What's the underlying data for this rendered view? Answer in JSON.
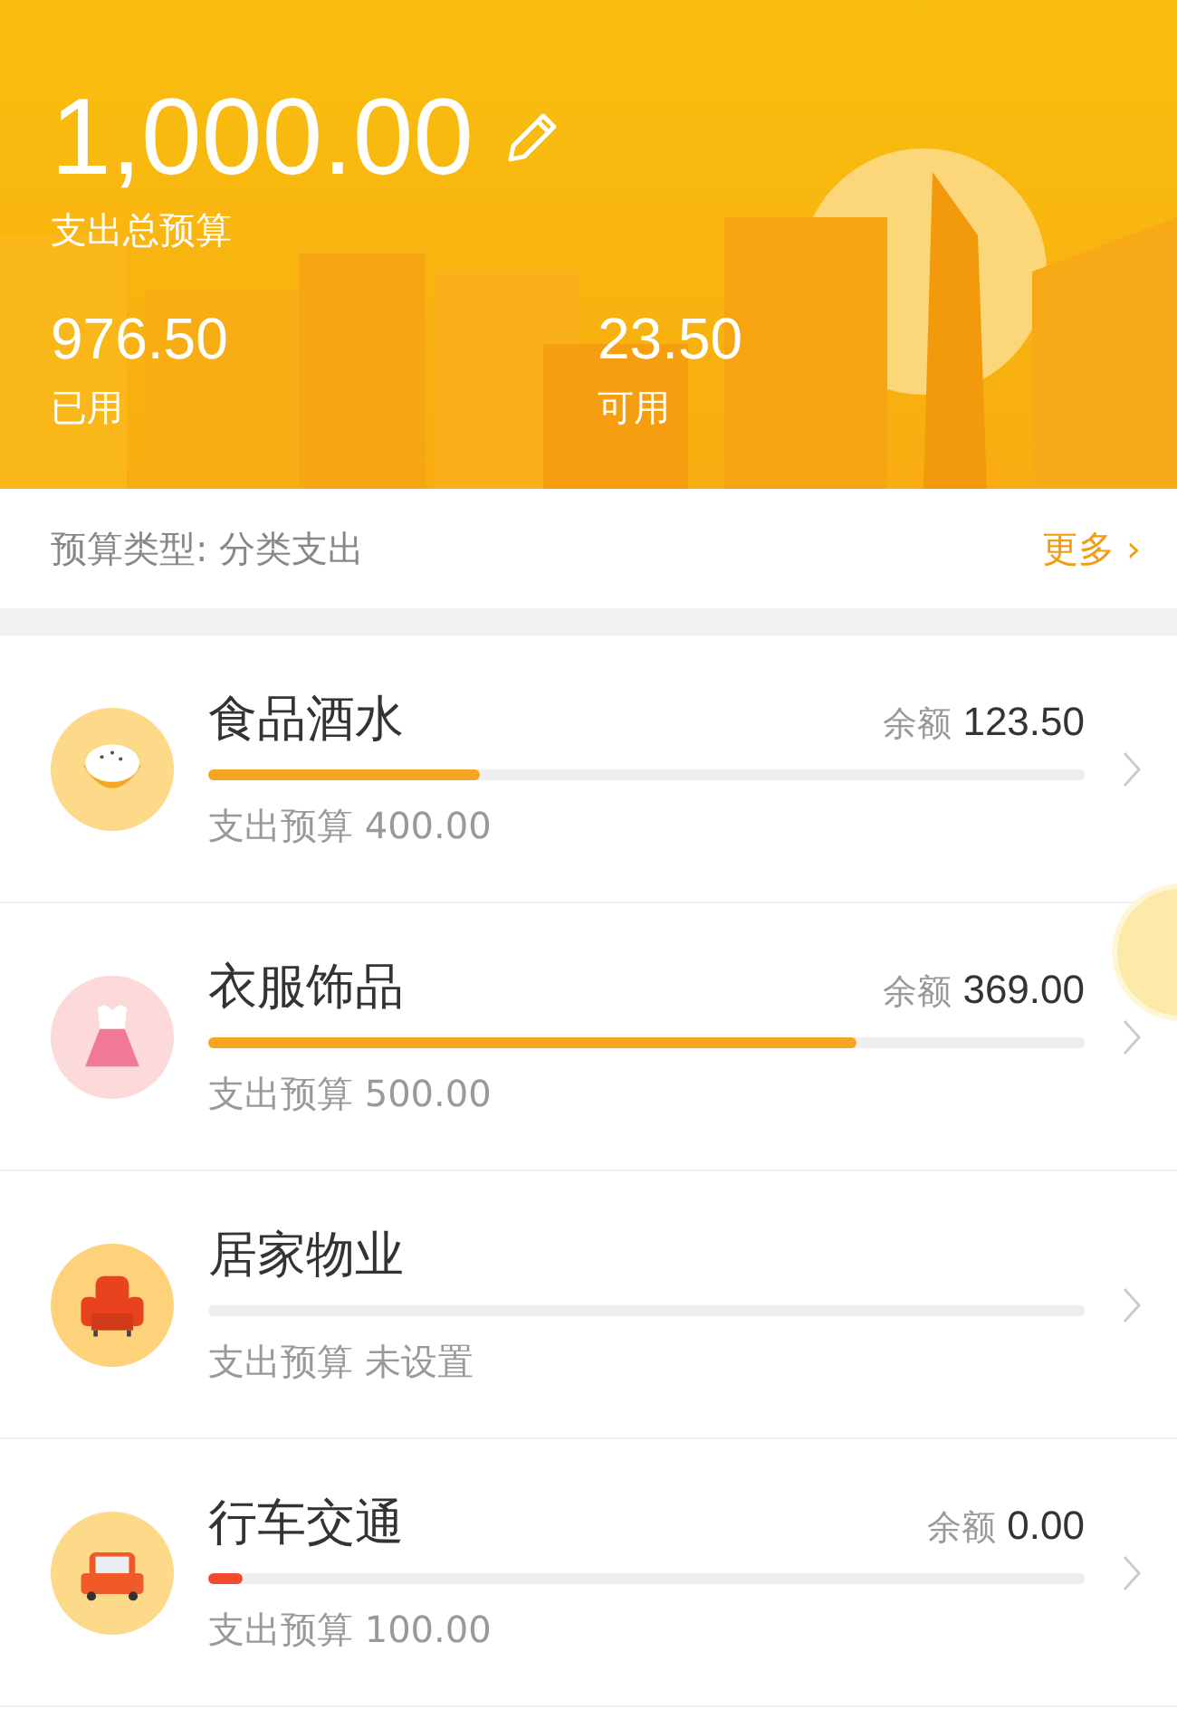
{
  "header": {
    "total": "1,000.00",
    "total_label": "支出总预算",
    "stats": [
      {
        "value": "976.50",
        "label": "已用"
      },
      {
        "value": "23.50",
        "label": "可用"
      }
    ]
  },
  "type_bar": {
    "label": "预算类型: 分类支出",
    "more": "更多",
    "more_arrow": "›"
  },
  "categories": [
    {
      "kind": "food",
      "name": "食品酒水",
      "balance_label": "余额",
      "balance": "123.50",
      "level": 0.31,
      "color": "#f6a623",
      "budget_label": "支出预算",
      "budget": "400.00"
    },
    {
      "kind": "clothing",
      "name": "衣服饰品",
      "balance_label": "余额",
      "balance": "369.00",
      "level": 0.74,
      "color": "#f6a623",
      "budget_label": "支出预算",
      "budget": "500.00"
    },
    {
      "kind": "home",
      "name": "居家物业",
      "level": 0,
      "budget_label": "支出预算",
      "budget": "未设置"
    },
    {
      "kind": "car",
      "name": "行车交通",
      "balance_label": "余额",
      "balance": "0.00",
      "level": 0.04,
      "color": "#f24b32",
      "budget_label": "支出预算",
      "budget": "100.00"
    }
  ]
}
